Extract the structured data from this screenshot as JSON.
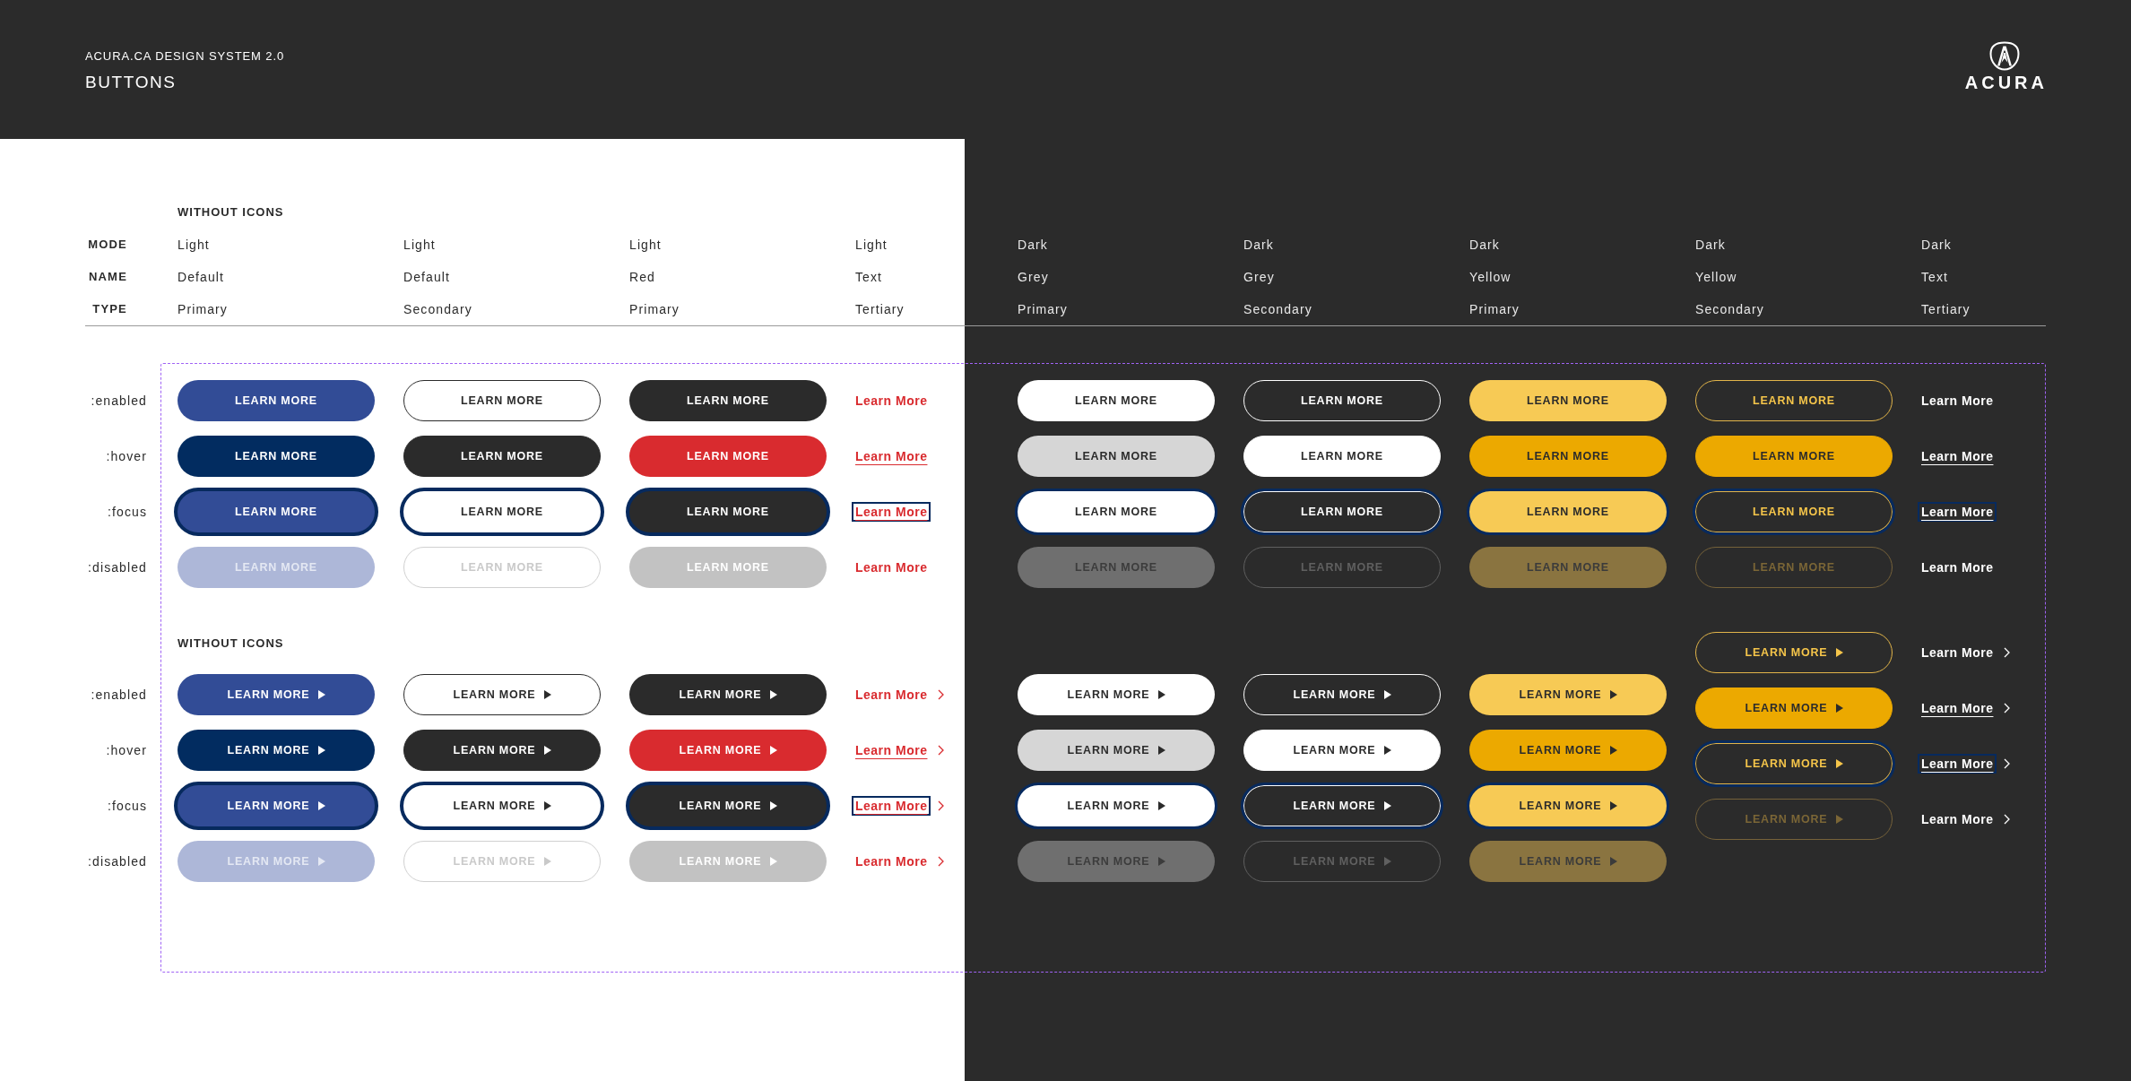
{
  "header": {
    "overline": "ACURA.CA DESIGN SYSTEM 2.0",
    "title": "BUTTONS",
    "logo_text": "ACURA"
  },
  "spec": {
    "heading": "WITHOUT ICONS",
    "columns": [
      {
        "kind": "blue"
      },
      {
        "kind": "outline"
      },
      {
        "kind": "red"
      },
      {
        "kind": "redlink"
      },
      {
        "kind": "white"
      },
      {
        "kind": "ghost"
      },
      {
        "kind": "yellow"
      },
      {
        "kind": "goldline"
      },
      {
        "kind": "whitelink"
      }
    ],
    "rows": [
      {
        "label": "MODE",
        "values": [
          "Light",
          "Light",
          "Light",
          "Light",
          "Dark",
          "Dark",
          "Dark",
          "Dark",
          "Dark"
        ]
      },
      {
        "label": "NAME",
        "values": [
          "Default",
          "Default",
          "Red",
          "Text",
          "Grey",
          "Grey",
          "Yellow",
          "Yellow",
          "Text"
        ]
      },
      {
        "label": "TYPE",
        "values": [
          "Primary",
          "Secondary",
          "Primary",
          "Tertiary",
          "Primary",
          "Secondary",
          "Primary",
          "Secondary",
          "Tertiary"
        ]
      }
    ]
  },
  "sections": [
    {
      "trailing_icon": false,
      "state_labels": [
        ":enabled",
        ":hover",
        ":focus",
        ":disabled"
      ],
      "columns": [
        {
          "buttons": [
            {
              "label": "LEARN MORE",
              "hovered": false,
              "focused": false,
              "disabled": false
            },
            {
              "label": "LEARN MORE",
              "hovered": true,
              "focused": false,
              "disabled": false
            },
            {
              "label": "LEARN MORE",
              "hovered": false,
              "focused": true,
              "disabled": false
            },
            {
              "label": "LEARN MORE",
              "hovered": false,
              "focused": false,
              "disabled": true
            }
          ]
        },
        {
          "buttons": [
            {
              "label": "LEARN MORE",
              "hovered": false,
              "focused": false,
              "disabled": false
            },
            {
              "label": "LEARN MORE",
              "hovered": true,
              "focused": false,
              "disabled": false
            },
            {
              "label": "LEARN MORE",
              "hovered": false,
              "focused": true,
              "disabled": false
            },
            {
              "label": "LEARN MORE",
              "hovered": false,
              "focused": false,
              "disabled": true
            }
          ]
        },
        {
          "buttons": [
            {
              "label": "LEARN MORE",
              "hovered": false,
              "focused": false,
              "disabled": false
            },
            {
              "label": "LEARN MORE",
              "hovered": true,
              "focused": false,
              "disabled": false
            },
            {
              "label": "LEARN MORE",
              "hovered": false,
              "focused": true,
              "disabled": false
            },
            {
              "label": "LEARN MORE",
              "hovered": false,
              "focused": false,
              "disabled": true
            }
          ]
        },
        {
          "buttons": [
            {
              "label": "Learn More",
              "hovered": false,
              "focused": false
            },
            {
              "label": "Learn More",
              "hovered": true,
              "focused": false
            },
            {
              "label": "Learn More",
              "hovered": false,
              "focused": true
            },
            {
              "label": "Learn More",
              "hovered": false,
              "focused": false
            }
          ]
        },
        {
          "buttons": [
            {
              "label": "LEARN MORE",
              "hovered": false,
              "focused": false,
              "disabled": false
            },
            {
              "label": "LEARN MORE",
              "hovered": true,
              "focused": false,
              "disabled": false
            },
            {
              "label": "LEARN MORE",
              "hovered": false,
              "focused": true,
              "disabled": false
            },
            {
              "label": "LEARN MORE",
              "hovered": false,
              "focused": false,
              "disabled": true
            }
          ]
        },
        {
          "buttons": [
            {
              "label": "LEARN MORE",
              "hovered": false,
              "focused": false,
              "disabled": false
            },
            {
              "label": "LEARN MORE",
              "hovered": true,
              "focused": false,
              "disabled": false
            },
            {
              "label": "LEARN MORE",
              "hovered": false,
              "focused": true,
              "disabled": false
            },
            {
              "label": "LEARN MORE",
              "hovered": false,
              "focused": false,
              "disabled": true
            }
          ]
        },
        {
          "buttons": [
            {
              "label": "LEARN MORE",
              "hovered": false,
              "focused": false,
              "disabled": false
            },
            {
              "label": "LEARN MORE",
              "hovered": true,
              "focused": false,
              "disabled": false
            },
            {
              "label": "LEARN MORE",
              "hovered": false,
              "focused": true,
              "disabled": false
            },
            {
              "label": "LEARN MORE",
              "hovered": false,
              "focused": false,
              "disabled": true
            }
          ]
        },
        {
          "buttons": [
            {
              "label": "LEARN MORE",
              "hovered": false,
              "focused": false,
              "disabled": false
            },
            {
              "label": "LEARN MORE",
              "hovered": true,
              "focused": false,
              "disabled": false
            },
            {
              "label": "LEARN MORE",
              "hovered": false,
              "focused": true,
              "disabled": false
            },
            {
              "label": "LEARN MORE",
              "hovered": false,
              "focused": false,
              "disabled": true
            }
          ]
        },
        {
          "buttons": [
            {
              "label": "Learn More",
              "hovered": false,
              "focused": false
            },
            {
              "label": "Learn More",
              "hovered": true,
              "focused": false
            },
            {
              "label": "Learn More",
              "hovered": false,
              "focused": true
            },
            {
              "label": "Learn More",
              "hovered": false,
              "focused": false
            }
          ]
        }
      ]
    },
    {
      "heading": "WITHOUT ICONS",
      "trailing_icon": true,
      "state_labels": [
        ":enabled",
        ":hover",
        ":focus",
        ":disabled"
      ],
      "columns": [
        {
          "buttons": [
            {
              "label": "LEARN MORE",
              "hovered": false,
              "focused": false,
              "disabled": false
            },
            {
              "label": "LEARN MORE",
              "hovered": true,
              "focused": false,
              "disabled": false
            },
            {
              "label": "LEARN MORE",
              "hovered": false,
              "focused": true,
              "disabled": false
            },
            {
              "label": "LEARN MORE",
              "hovered": false,
              "focused": false,
              "disabled": true
            }
          ]
        },
        {
          "buttons": [
            {
              "label": "LEARN MORE",
              "hovered": false,
              "focused": false,
              "disabled": false
            },
            {
              "label": "LEARN MORE",
              "hovered": true,
              "focused": false,
              "disabled": false
            },
            {
              "label": "LEARN MORE",
              "hovered": false,
              "focused": true,
              "disabled": false
            },
            {
              "label": "LEARN MORE",
              "hovered": false,
              "focused": false,
              "disabled": true
            }
          ]
        },
        {
          "buttons": [
            {
              "label": "LEARN MORE",
              "hovered": false,
              "focused": false,
              "disabled": false
            },
            {
              "label": "LEARN MORE",
              "hovered": true,
              "focused": false,
              "disabled": false
            },
            {
              "label": "LEARN MORE",
              "hovered": false,
              "focused": true,
              "disabled": false
            },
            {
              "label": "LEARN MORE",
              "hovered": false,
              "focused": false,
              "disabled": true
            }
          ]
        },
        {
          "buttons": [
            {
              "label": "Learn More",
              "hovered": false,
              "focused": false
            },
            {
              "label": "Learn More",
              "hovered": true,
              "focused": false
            },
            {
              "label": "Learn More",
              "hovered": false,
              "focused": true
            },
            {
              "label": "Learn More",
              "hovered": false,
              "focused": false
            }
          ]
        },
        {
          "buttons": [
            {
              "label": "LEARN MORE",
              "hovered": false,
              "focused": false,
              "disabled": false
            },
            {
              "label": "LEARN MORE",
              "hovered": true,
              "focused": false,
              "disabled": false
            },
            {
              "label": "LEARN MORE",
              "hovered": false,
              "focused": true,
              "disabled": false
            },
            {
              "label": "LEARN MORE",
              "hovered": false,
              "focused": false,
              "disabled": true
            }
          ]
        },
        {
          "buttons": [
            {
              "label": "LEARN MORE",
              "hovered": false,
              "focused": false,
              "disabled": false
            },
            {
              "label": "LEARN MORE",
              "hovered": true,
              "focused": false,
              "disabled": false
            },
            {
              "label": "LEARN MORE",
              "hovered": false,
              "focused": true,
              "disabled": false
            },
            {
              "label": "LEARN MORE",
              "hovered": false,
              "focused": false,
              "disabled": true
            }
          ]
        },
        {
          "buttons": [
            {
              "label": "LEARN MORE",
              "hovered": false,
              "focused": false,
              "disabled": false
            },
            {
              "label": "LEARN MORE",
              "hovered": true,
              "focused": false,
              "disabled": false
            },
            {
              "label": "LEARN MORE",
              "hovered": false,
              "focused": true,
              "disabled": false
            },
            {
              "label": "LEARN MORE",
              "hovered": false,
              "focused": false,
              "disabled": true
            }
          ]
        },
        {
          "buttons": [
            {
              "label": "LEARN MORE",
              "hovered": false,
              "focused": false,
              "disabled": false
            },
            {
              "label": "LEARN MORE",
              "hovered": true,
              "focused": false,
              "disabled": false
            },
            {
              "label": "LEARN MORE",
              "hovered": false,
              "focused": true,
              "disabled": false
            },
            {
              "label": "LEARN MORE",
              "hovered": false,
              "focused": false,
              "disabled": true
            }
          ]
        },
        {
          "buttons": [
            {
              "label": "Learn More",
              "hovered": false,
              "focused": false
            },
            {
              "label": "Learn More",
              "hovered": true,
              "focused": false
            },
            {
              "label": "Learn More",
              "hovered": false,
              "focused": true
            },
            {
              "label": "Learn More",
              "hovered": false,
              "focused": false
            }
          ]
        }
      ]
    }
  ]
}
